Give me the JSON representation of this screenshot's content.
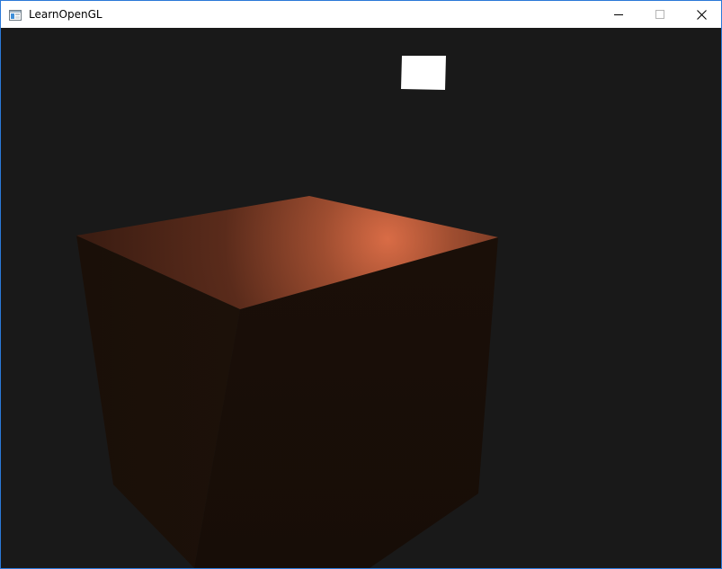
{
  "window": {
    "title": "LearnOpenGL"
  },
  "title_controls": {
    "minimize_icon": "minimize-icon",
    "maximize_icon": "maximize-icon",
    "close_icon": "close-icon"
  },
  "scene": {
    "background_color": "#191919",
    "light_color": "#ffffff",
    "cube_highlight_color": "#d76a45",
    "cube_base_color": "#1a0f08"
  }
}
